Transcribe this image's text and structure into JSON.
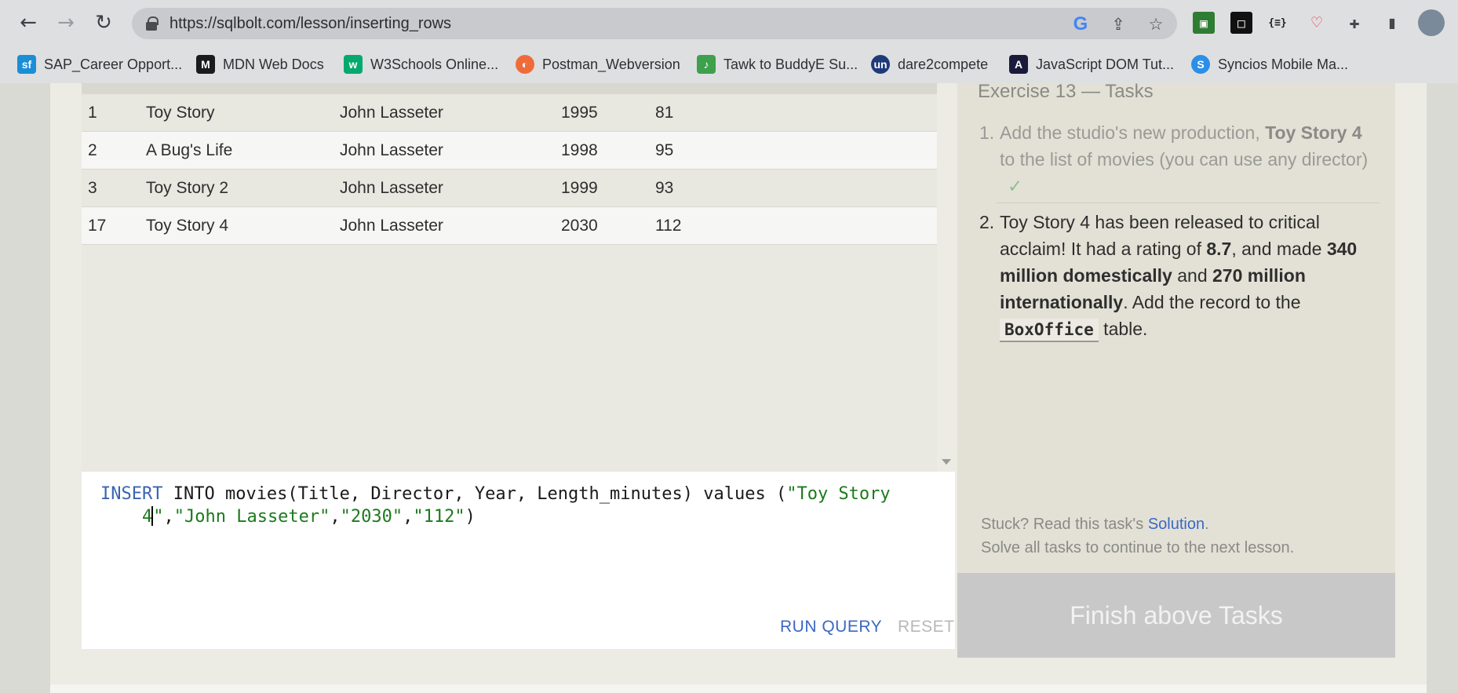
{
  "browser": {
    "url": "https://sqlbolt.com/lesson/inserting_rows",
    "back_icon": "←",
    "forward_icon": "→",
    "reload_icon": "↻",
    "share_icon": "⇪",
    "star_icon": "☆",
    "json_ext": "{≡}",
    "puzzle_icon": "✚",
    "sidepanel_icon": "▮"
  },
  "bookmarks": [
    {
      "label": "SAP_Career Opport...",
      "fav_text": "sf",
      "fav_color": "#1a8fd6"
    },
    {
      "label": "MDN Web Docs",
      "fav_text": "M",
      "fav_color": "#1b1b1b"
    },
    {
      "label": "W3Schools Online...",
      "fav_text": "w",
      "fav_color": "#04aa6d"
    },
    {
      "label": "Postman_Webversion",
      "fav_text": "◐",
      "fav_color": "#ef6c3a"
    },
    {
      "label": "Tawk to BuddyE Su...",
      "fav_text": "♪",
      "fav_color": "#3ea04c"
    },
    {
      "label": "dare2compete",
      "fav_text": "un",
      "fav_color": "#1f3a7a"
    },
    {
      "label": "JavaScript DOM Tut...",
      "fav_text": "A",
      "fav_color": "#1a1a3a"
    },
    {
      "label": "Syncios Mobile Ma...",
      "fav_text": "S",
      "fav_color": "#2b8fe8"
    }
  ],
  "results": {
    "rows": [
      {
        "id": "1",
        "title": "Toy Story",
        "director": "John Lasseter",
        "year": "1995",
        "length": "81"
      },
      {
        "id": "2",
        "title": "A Bug's Life",
        "director": "John Lasseter",
        "year": "1998",
        "length": "95"
      },
      {
        "id": "3",
        "title": "Toy Story 2",
        "director": "John Lasseter",
        "year": "1999",
        "length": "93"
      },
      {
        "id": "17",
        "title": "Toy Story 4",
        "director": "John Lasseter",
        "year": "2030",
        "length": "112"
      }
    ]
  },
  "editor": {
    "kw_insert": "INSERT",
    "line1_rest": " INTO movies(Title, Director, Year, Length_minutes) values (",
    "line1_str": "\"Toy Story",
    "line2_indent": "    ",
    "line2_str1": "4",
    "line2_str2": "\"",
    "line2_comma1": ",",
    "line2_str3": "\"John Lasseter\"",
    "line2_comma2": ",",
    "line2_str4": "\"2030\"",
    "line2_comma3": ",",
    "line2_str5": "\"112\"",
    "line2_end": ")",
    "run_label": "RUN QUERY",
    "reset_label": "RESET"
  },
  "tasks": {
    "title": "Exercise 13 — Tasks",
    "t1_num": "1.",
    "t1_a": "Add the studio's new production, ",
    "t1_b": "Toy Story 4",
    "t1_c": " to the list of movies (you can use any director)",
    "t1_check": "✓",
    "t2_num": "2.",
    "t2_a": "Toy Story 4 has been released to critical acclaim! It had a rating of ",
    "t2_b": "8.7",
    "t2_c": ", and made ",
    "t2_d": "340 million domestically",
    "t2_e": " and ",
    "t2_f": "270 million internationally",
    "t2_g": ". Add the record to the ",
    "t2_code": "BoxOffice",
    "t2_h": " table.",
    "stuck_a": "Stuck? Read this task's ",
    "stuck_link": "Solution",
    "stuck_b": ".",
    "stuck_line2": "Solve all tasks to continue to the next lesson.",
    "finish_label": "Finish above Tasks"
  }
}
